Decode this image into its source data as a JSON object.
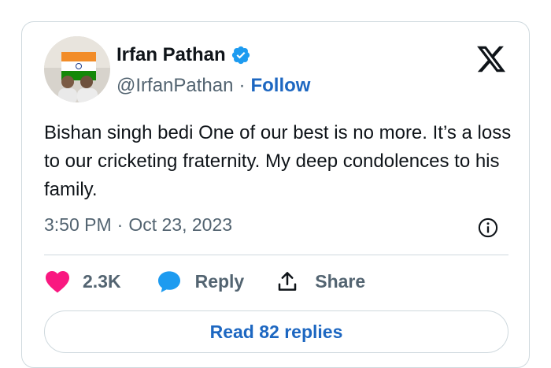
{
  "author": {
    "name": "Irfan Pathan",
    "handle": "@IrfanPathan",
    "separator": "·",
    "follow_label": "Follow"
  },
  "tweet": {
    "text": "Bishan singh bedi One of our best is no more. It’s a loss to our cricketing fraternity. My deep condolences to his family.",
    "time": "3:50 PM",
    "date_separator": "·",
    "date": "Oct 23, 2023"
  },
  "actions": {
    "like_count": "2.3K",
    "reply_label": "Reply",
    "share_label": "Share"
  },
  "read_replies_label": "Read 82 replies",
  "icons": {
    "verified": "verified-badge-icon",
    "brand": "x-logo-icon",
    "info": "info-icon",
    "like": "heart-icon",
    "reply": "speech-bubble-icon",
    "share": "upload-share-icon"
  },
  "colors": {
    "link_blue": "#1d67c1",
    "verified_blue": "#1d9bf0",
    "heart_pink": "#f91880",
    "muted_gray": "#536471",
    "border": "#cfd9de"
  }
}
